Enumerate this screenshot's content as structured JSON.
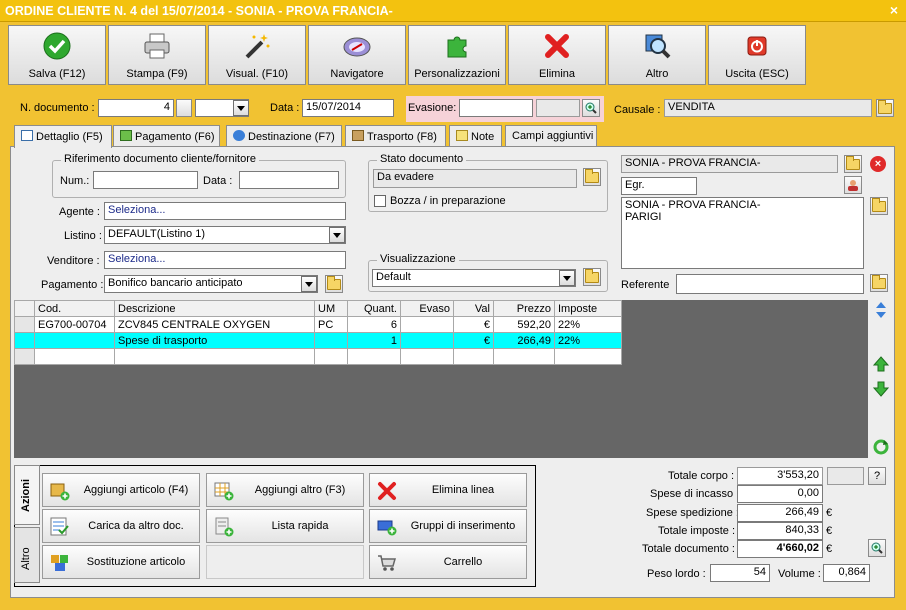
{
  "window": {
    "title": "ORDINE CLIENTE N. 4 del 15/07/2014 - SONIA - PROVA FRANCIA-",
    "close": "×"
  },
  "toolbar": [
    {
      "label": "Salva (F12)",
      "icon": "check-icon"
    },
    {
      "label": "Stampa (F9)",
      "icon": "printer-icon"
    },
    {
      "label": "Visual. (F10)",
      "icon": "magic-wand-icon"
    },
    {
      "label": "Navigatore",
      "icon": "compass-icon"
    },
    {
      "label": "Personalizzazioni",
      "icon": "puzzle-icon"
    },
    {
      "label": "Elimina",
      "icon": "delete-x-icon"
    },
    {
      "label": "Altro",
      "icon": "magnifier-icon"
    },
    {
      "label": "Uscita (ESC)",
      "icon": "power-icon"
    }
  ],
  "header": {
    "ndoc_label": "N. documento :",
    "ndoc_value": "4",
    "data_label": "Data :",
    "data_value": "15/07/2014",
    "evasione_label": "Evasione:",
    "evasione_value": "",
    "causale_label": "Causale :",
    "causale_value": "VENDITA"
  },
  "tabs": [
    "Dettaglio (F5)",
    "Pagamento (F6)",
    "Destinazione (F7)",
    "Trasporto (F8)",
    "Note",
    "Campi aggiuntivi"
  ],
  "riferimento": {
    "title": "Riferimento documento cliente/fornitore",
    "num_label": "Num.:",
    "num_value": "",
    "data_label": "Data :",
    "data_value": ""
  },
  "stato": {
    "title": "Stato documento",
    "value": "Da evadere",
    "bozza_label": "Bozza / in preparazione"
  },
  "fields": {
    "agente_label": "Agente :",
    "agente_value": "Seleziona...",
    "listino_label": "Listino :",
    "listino_value": "DEFAULT(Listino 1)",
    "venditore_label": "Venditore :",
    "venditore_value": "Seleziona...",
    "pagamento_label": "Pagamento :",
    "pagamento_value": "Bonifico bancario anticipato"
  },
  "visualizzazione": {
    "title": "Visualizzazione",
    "value": "Default"
  },
  "cliente": {
    "name": "SONIA - PROVA FRANCIA-",
    "title": "Egr.",
    "address_line1": "SONIA - PROVA FRANCIA-",
    "address_line2": "PARIGI",
    "referente_label": "Referente",
    "referente_value": ""
  },
  "grid": {
    "columns": [
      "Cod.",
      "Descrizione",
      "UM",
      "Quant.",
      "Evaso",
      "Val",
      "Prezzo",
      "Imposte"
    ],
    "rows": [
      [
        "EG700-00704",
        "ZCV845 CENTRALE OXYGEN",
        "PC",
        "6",
        "",
        "€",
        "592,20",
        "22%"
      ],
      [
        "",
        "Spese di trasporto",
        "",
        "1",
        "",
        "€",
        "266,49",
        "22%"
      ],
      [
        "",
        "",
        "",
        "",
        "",
        "",
        "",
        ""
      ]
    ]
  },
  "side_tabs": [
    "Azioni",
    "Altro"
  ],
  "actions": [
    {
      "label": "Aggiungi articolo (F4)",
      "icon": "add-box-icon"
    },
    {
      "label": "Aggiungi altro (F3)",
      "icon": "add-grid-icon"
    },
    {
      "label": "Elimina linea",
      "icon": "delete-line-icon"
    },
    {
      "label": "Carica da altro doc.",
      "icon": "load-doc-icon"
    },
    {
      "label": "Lista rapida",
      "icon": "quick-list-icon"
    },
    {
      "label": "Gruppi di inserimento",
      "icon": "group-insert-icon"
    },
    {
      "label": "Sostituzione articolo",
      "icon": "replace-icon"
    },
    {
      "label": "",
      "icon": "none"
    },
    {
      "label": "Carrello",
      "icon": "cart-icon"
    }
  ],
  "totals": {
    "corpo_label": "Totale corpo :",
    "corpo_value": "3'553,20",
    "help": "?",
    "incasso_label": "Spese di incasso :",
    "incasso_value": "0,00",
    "spedizione_label": "Spese spedizione :",
    "spedizione_value": "266,49",
    "imposte_label": "Totale imposte :",
    "imposte_value": "840,33",
    "documento_label": "Totale documento :",
    "documento_value": "4'660,02",
    "currency": "€",
    "peso_label": "Peso lordo :",
    "peso_value": "54",
    "volume_label": "Volume :",
    "volume_value": "0,864"
  }
}
